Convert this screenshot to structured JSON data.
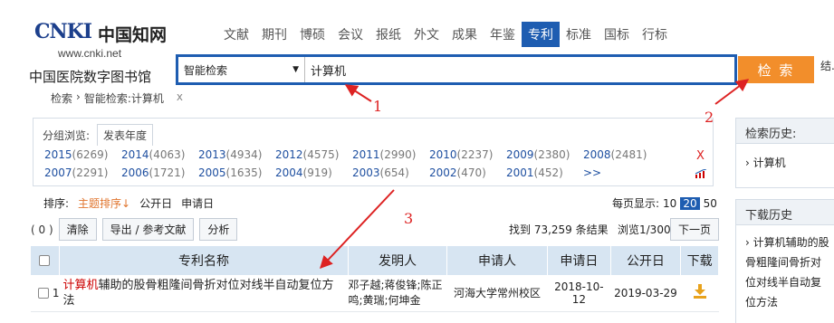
{
  "logo": {
    "brand": "CNKI",
    "brand_cn": "中国知网",
    "url_text": "www.cnki.net"
  },
  "library_name": "中国医院数字图书馆",
  "nav": {
    "items": [
      "文献",
      "期刊",
      "博硕",
      "会议",
      "报纸",
      "外文",
      "成果",
      "年鉴",
      "专利",
      "标准",
      "国标",
      "行标"
    ],
    "active_index": 8
  },
  "search": {
    "select_value": "智能检索",
    "input_value": "计算机",
    "button_label": "检 索",
    "results_link": "结..."
  },
  "breadcrumb": {
    "items": [
      "检索",
      "›",
      "智能检索:计算机"
    ],
    "close": "x"
  },
  "annotations": {
    "a1": "1",
    "a2": "2",
    "a3": "3"
  },
  "group": {
    "label": "分组浏览:",
    "tab": "发表年度",
    "years_row1": [
      {
        "year": "2015",
        "count": "(6269)"
      },
      {
        "year": "2014",
        "count": "(4063)"
      },
      {
        "year": "2013",
        "count": "(4934)"
      },
      {
        "year": "2012",
        "count": "(4575)"
      },
      {
        "year": "2011",
        "count": "(2990)"
      },
      {
        "year": "2010",
        "count": "(2237)"
      },
      {
        "year": "2009",
        "count": "(2380)"
      },
      {
        "year": "2008",
        "count": "(2481)"
      }
    ],
    "years_row2": [
      {
        "year": "2007",
        "count": "(2291)"
      },
      {
        "year": "2006",
        "count": "(1721)"
      },
      {
        "year": "2005",
        "count": "(1635)"
      },
      {
        "year": "2004",
        "count": "(919)"
      },
      {
        "year": "2003",
        "count": "(654)"
      },
      {
        "year": "2002",
        "count": "(470)"
      },
      {
        "year": "2001",
        "count": "(452)"
      }
    ],
    "more": ">>",
    "close": "X"
  },
  "sort": {
    "label": "排序:",
    "options": [
      "主题排序↓",
      "公开日",
      "申请日"
    ],
    "per_page_label": "每页显示:",
    "per_page": [
      "10",
      "20",
      "50"
    ],
    "per_page_active": "20"
  },
  "toolbar": {
    "selected_count": "( 0 )",
    "clear": "清除",
    "export": "导出 / 参考文献",
    "analyze": "分析",
    "found": "找到 73,259 条结果",
    "pageinfo": "浏览1/300",
    "next": "下一页"
  },
  "table": {
    "headers": [
      "专利名称",
      "发明人",
      "申请人",
      "申请日",
      "公开日",
      "下载"
    ],
    "rows": [
      {
        "num": "1",
        "title_hl": "计算机",
        "title_rest": "辅助的股骨粗隆间骨折对位对线半自动复位方法",
        "inventors": "邓子越;蒋俊锋;陈正鸣;黄瑞;何坤金",
        "applicant": "河海大学常州校区",
        "apply_date": "2018-10-12",
        "pub_date": "2019-03-29"
      }
    ]
  },
  "side": {
    "history_title": "检索历史:",
    "history_item": "› 计算机",
    "download_title": "下载历史",
    "download_item": "› 计算机辅助的股骨粗隆间骨折对位对线半自动复位方法"
  },
  "colors": {
    "brand_blue": "#1e5db1",
    "search_orange": "#f28e2b",
    "highlight_red": "#cc0000"
  }
}
